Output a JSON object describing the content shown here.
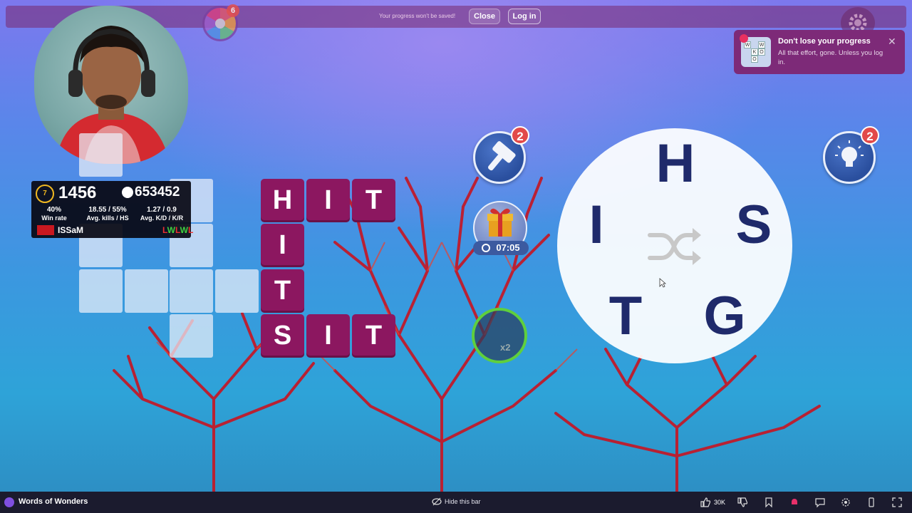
{
  "topbar": {
    "notice": "Your progress won't be saved!",
    "close_label": "Close",
    "login_label": "Log in",
    "spin_badge": "6"
  },
  "stats": {
    "level": "7",
    "elo": "1456",
    "rank": "653452",
    "winrate_value": "40%",
    "winrate_label": "Win rate",
    "kills_value": "18.55 / 55%",
    "kills_label": "Avg. kills / HS",
    "kd_value": "1.27 / 0.9",
    "kd_label": "Avg. K/D / K/R",
    "player_name": "ISSaM",
    "recent_form": [
      "L",
      "W",
      "L",
      "W",
      "L"
    ]
  },
  "crossword": {
    "words": [
      "HIT",
      "HITS",
      "SIT"
    ],
    "tiles": {
      "h1": "H",
      "i1": "I",
      "t1": "T",
      "i2": "I",
      "t2": "T",
      "s3": "S",
      "i3": "I",
      "t3": "T"
    }
  },
  "powerups": {
    "hammer_count": "2",
    "hint_count": "2",
    "gift_timer": "07:05",
    "multiplier_label": "x2"
  },
  "wheel": {
    "letters": {
      "top": "H",
      "left": "I",
      "right": "S",
      "bottom_left": "T",
      "bottom_right": "G"
    }
  },
  "toast": {
    "title": "Don't lose your progress",
    "body": "All that effort, gone. Unless you log in.",
    "thumb_letters": [
      "W",
      "K",
      "O",
      "W",
      "O"
    ]
  },
  "bottombar": {
    "game_name": "Words of Wonders",
    "hide_label": "Hide this bar",
    "like_count": "30K"
  },
  "colors": {
    "tile": "#8c1760",
    "wheel_letter": "#1f2a6b",
    "badge": "#e24a4a",
    "toast": "#7d2a78",
    "bottombar": "#1b1b2e"
  }
}
